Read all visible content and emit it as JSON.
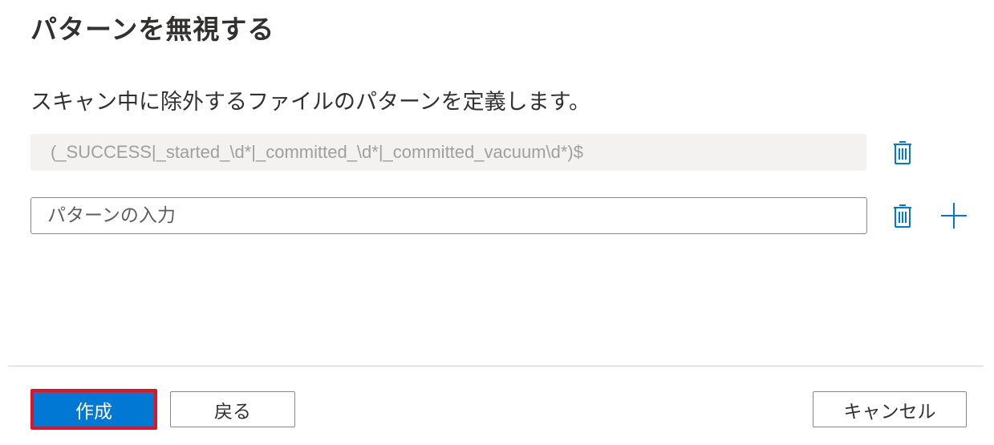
{
  "header": {
    "title": "パターンを無視する"
  },
  "description": "スキャン中に除外するファイルのパターンを定義します。",
  "patterns": [
    {
      "value": "(_SUCCESS|_started_\\d*|_committed_\\d*|_committed_vacuum\\d*)$",
      "editable": false
    },
    {
      "value": "",
      "placeholder": "パターンの入力",
      "editable": true
    }
  ],
  "icons": {
    "delete": "trash-icon",
    "add": "plus-icon"
  },
  "footer": {
    "create_label": "作成",
    "back_label": "戻る",
    "cancel_label": "キャンセル"
  },
  "colors": {
    "accent": "#0078d4",
    "highlight_border": "#e81123",
    "readonly_bg": "#f3f2f1"
  }
}
